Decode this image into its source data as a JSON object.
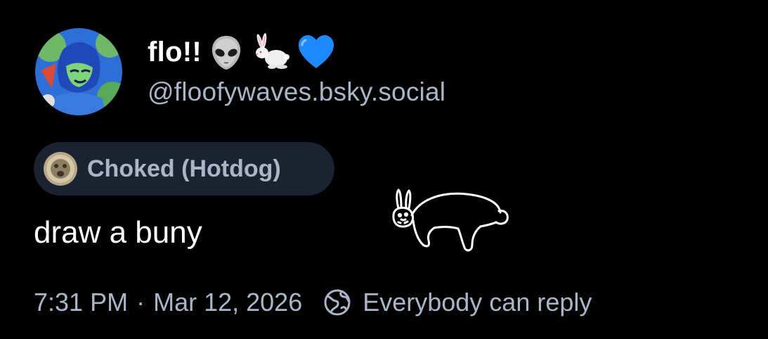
{
  "author": {
    "display_name": "flo!!",
    "emojis": [
      "alien-emoji",
      "rabbit-emoji",
      "blue-heart-emoji"
    ],
    "handle": "@floofywaves.bsky.social"
  },
  "label": {
    "text": "Choked (Hotdog)"
  },
  "post": {
    "text": "draw a buny"
  },
  "meta": {
    "time": "7:31 PM",
    "separator": "·",
    "date": "Mar 12, 2026",
    "reply_setting": "Everybody can reply"
  },
  "colors": {
    "background": "#000000",
    "text_primary": "#ffffff",
    "text_secondary": "#a9b6c8",
    "chip_background": "#1b2331",
    "heart": "#1e88ff"
  }
}
